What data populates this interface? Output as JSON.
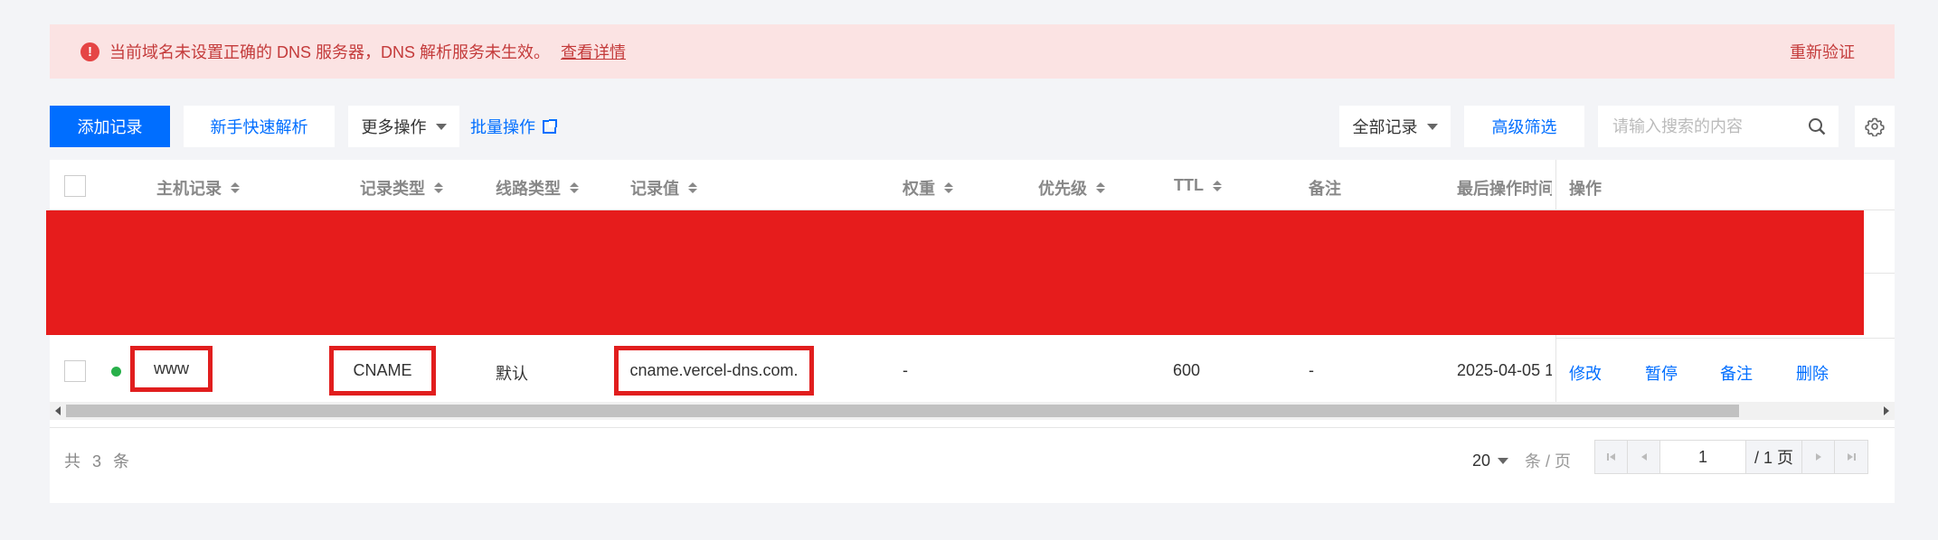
{
  "alert": {
    "icon": "error-info-icon",
    "message": "当前域名未设置正确的 DNS 服务器，DNS 解析服务未生效。",
    "link": "查看详情",
    "action": "重新验证"
  },
  "toolbar": {
    "add_record": "添加记录",
    "quick_parse": "新手快速解析",
    "more_ops": "更多操作",
    "batch_ops": "批量操作",
    "filter_all": "全部记录",
    "advanced_filter": "高级筛选",
    "search_placeholder": "请输入搜索的内容"
  },
  "table": {
    "columns": [
      "主机记录",
      "记录类型",
      "线路类型",
      "记录值",
      "权重",
      "优先级",
      "TTL",
      "备注",
      "最后操作时间",
      "操作"
    ],
    "row": {
      "host": "www",
      "type": "CNAME",
      "line": "默认",
      "value": "cname.vercel-dns.com.",
      "weight": "-",
      "priority": "",
      "ttl": "600",
      "remark": "-",
      "last_modified": "2025-04-05 1",
      "actions": [
        "修改",
        "暂停",
        "备注",
        "删除"
      ]
    }
  },
  "pagination": {
    "total": "共 3 条",
    "page_size": "20",
    "page_size_unit": "条 / 页",
    "current_page": "1",
    "total_pages": "/ 1 页"
  },
  "colors": {
    "primary": "#006eff",
    "alert_bg": "#fbe3e3",
    "alert_text": "#c43b3b",
    "highlight": "#e11e1e",
    "status_ok": "#28b04a"
  }
}
